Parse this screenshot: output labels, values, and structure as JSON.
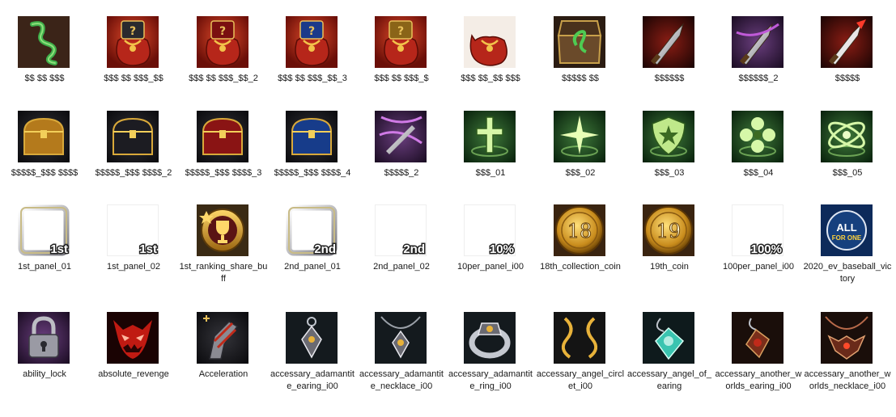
{
  "rows": [
    [
      {
        "label": "$$ $$ $$$",
        "icon": "green-serpent-icon"
      },
      {
        "label": "$$$ $$ $$$_$$",
        "icon": "red-pouch-black-box-icon"
      },
      {
        "label": "$$$ $$ $$$_$$_2",
        "icon": "red-pouch-red-box-icon"
      },
      {
        "label": "$$$ $$ $$$_$$_3",
        "icon": "red-pouch-blue-box-icon"
      },
      {
        "label": "$$$ $$ $$$_$",
        "icon": "red-pouch-gold-box-icon"
      },
      {
        "label": "$$$ $$_$$ $$$",
        "icon": "red-pouch-icon"
      },
      {
        "label": "$$$$$ $$",
        "icon": "open-chest-serpent-icon"
      },
      {
        "label": "$$$$$$",
        "icon": "crimson-dagger-icon"
      },
      {
        "label": "$$$$$$_2",
        "icon": "violet-dagger-icon"
      },
      {
        "label": "$$$$$",
        "icon": "red-blade-icon"
      }
    ],
    [
      {
        "label": "$$$$$_$$$ $$$$",
        "icon": "gold-chest-icon"
      },
      {
        "label": "$$$$$_$$$ $$$$_2",
        "icon": "black-chest-icon"
      },
      {
        "label": "$$$$$_$$$ $$$$_3",
        "icon": "red-chest-icon"
      },
      {
        "label": "$$$$$_$$$ $$$$_4",
        "icon": "blue-chest-icon"
      },
      {
        "label": "$$$$$_2",
        "icon": "ribbon-dagger-icon"
      },
      {
        "label": "$$$_01",
        "icon": "green-cross-icon"
      },
      {
        "label": "$$$_02",
        "icon": "green-star-icon"
      },
      {
        "label": "$$$_03",
        "icon": "green-shield-icon"
      },
      {
        "label": "$$$_04",
        "icon": "green-clover-icon"
      },
      {
        "label": "$$$_05",
        "icon": "green-orbit-icon"
      }
    ],
    [
      {
        "label": "1st_panel_01",
        "icon": "silver-frame-icon",
        "overlay": "1st"
      },
      {
        "label": "1st_panel_02",
        "icon": "blank-panel-icon",
        "overlay": "1st"
      },
      {
        "label": "1st_ranking_share_buff",
        "icon": "trophy-badge-icon"
      },
      {
        "label": "2nd_panel_01",
        "icon": "silver-frame-icon",
        "overlay": "2nd"
      },
      {
        "label": "2nd_panel_02",
        "icon": "blank-panel-icon",
        "overlay": "2nd"
      },
      {
        "label": "10per_panel_i00",
        "icon": "blank-panel-icon",
        "overlay": "10%"
      },
      {
        "label": "18th_collection_coin",
        "icon": "gold-coin-icon",
        "coin": "18"
      },
      {
        "label": "19th_coin",
        "icon": "gold-coin-icon",
        "coin": "19"
      },
      {
        "label": "100per_panel_i00",
        "icon": "blank-panel-icon",
        "overlay": "100%"
      },
      {
        "label": "2020_ev_baseball_victory",
        "icon": "baseball-badge-icon",
        "badge_top": "ALL",
        "badge_mid": "FOR ONE"
      }
    ],
    [
      {
        "label": "ability_lock",
        "icon": "padlock-icon"
      },
      {
        "label": "absolute_revenge",
        "icon": "demon-face-icon"
      },
      {
        "label": "Acceleration",
        "icon": "armored-gauntlet-icon"
      },
      {
        "label": "accessary_adamantite_earing_i00",
        "icon": "diamond-earring-icon"
      },
      {
        "label": "accessary_adamantite_necklace_i00",
        "icon": "diamond-necklace-icon"
      },
      {
        "label": "accessary_adamantite_ring_i00",
        "icon": "silver-ring-icon"
      },
      {
        "label": "accessary_angel_circlet_i00",
        "icon": "gold-circlet-icon"
      },
      {
        "label": "accessary_angel_of_earing",
        "icon": "teal-earring-icon"
      },
      {
        "label": "accessary_another_worlds_earing_i00",
        "icon": "crimson-earring-icon"
      },
      {
        "label": "accessary_another_worlds_necklace_i00",
        "icon": "bat-necklace-icon"
      }
    ]
  ]
}
